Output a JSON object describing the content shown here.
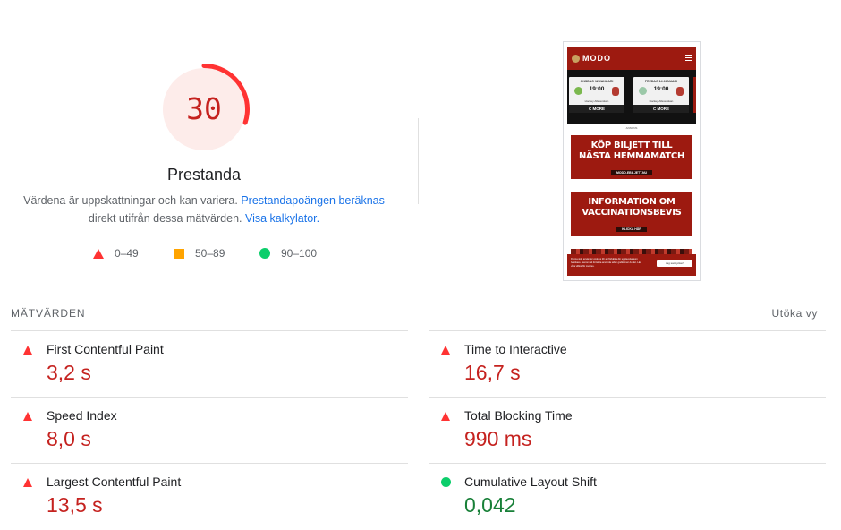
{
  "score": {
    "value": 30,
    "max": 100,
    "title": "Prestanda",
    "description_text": "Värdena är uppskattningar och kan variera. ",
    "description_link": "Prestandapoängen beräknas",
    "description_line2": "direkt utifrån dessa mätvärden. ",
    "calculator_link": "Visa kalkylator.",
    "color": "#ff3333",
    "track_color": "#fdecea"
  },
  "legend": [
    {
      "icon": "triangle-icon",
      "range": "0–49",
      "color": "#ff3333"
    },
    {
      "icon": "square-icon",
      "range": "50–89",
      "color": "#ffa400"
    },
    {
      "icon": "circle-icon",
      "range": "90–100",
      "color": "#0cce6b"
    }
  ],
  "screenshot": {
    "brand": "MODO",
    "games": [
      {
        "date": "ONSDAG 12 JANUARI",
        "time": "19:00",
        "teams": "Hockey   Allsvenskan",
        "stream": "C MORE"
      },
      {
        "date": "FREDAG 14 JANUARI",
        "time": "19:00",
        "teams": "Hockey   Allsvenskan",
        "stream": "C MORE"
      }
    ],
    "ad_label": "ANNONS",
    "banner1": {
      "line1": "KÖP BILJETT TILL",
      "line2": "NÄSTA HEMMAMATCH",
      "pill": "MODO.EBILJETT.NU"
    },
    "banner2": {
      "line1": "INFORMATION OM",
      "line2": "VACCINATIONSBEVIS",
      "pill": "KLICKA HÄR"
    },
    "cookie_text": "Denna sida använder cookies för att förbättra din upplevelse som besökare. Genom att fortsätta använda sidan godkänner du det. Läs våra villkor för cookies.",
    "cookie_button": "Jag samtycker!"
  },
  "metrics": {
    "title": "MÄTVÄRDEN",
    "expand_label": "Utöka vy",
    "items": [
      {
        "name": "First Contentful Paint",
        "value": "3,2 s",
        "status": "fail"
      },
      {
        "name": "Time to Interactive",
        "value": "16,7 s",
        "status": "fail"
      },
      {
        "name": "Speed Index",
        "value": "8,0 s",
        "status": "fail"
      },
      {
        "name": "Total Blocking Time",
        "value": "990 ms",
        "status": "fail"
      },
      {
        "name": "Largest Contentful Paint",
        "value": "13,5 s",
        "status": "fail"
      },
      {
        "name": "Cumulative Layout Shift",
        "value": "0,042",
        "status": "pass"
      }
    ]
  }
}
